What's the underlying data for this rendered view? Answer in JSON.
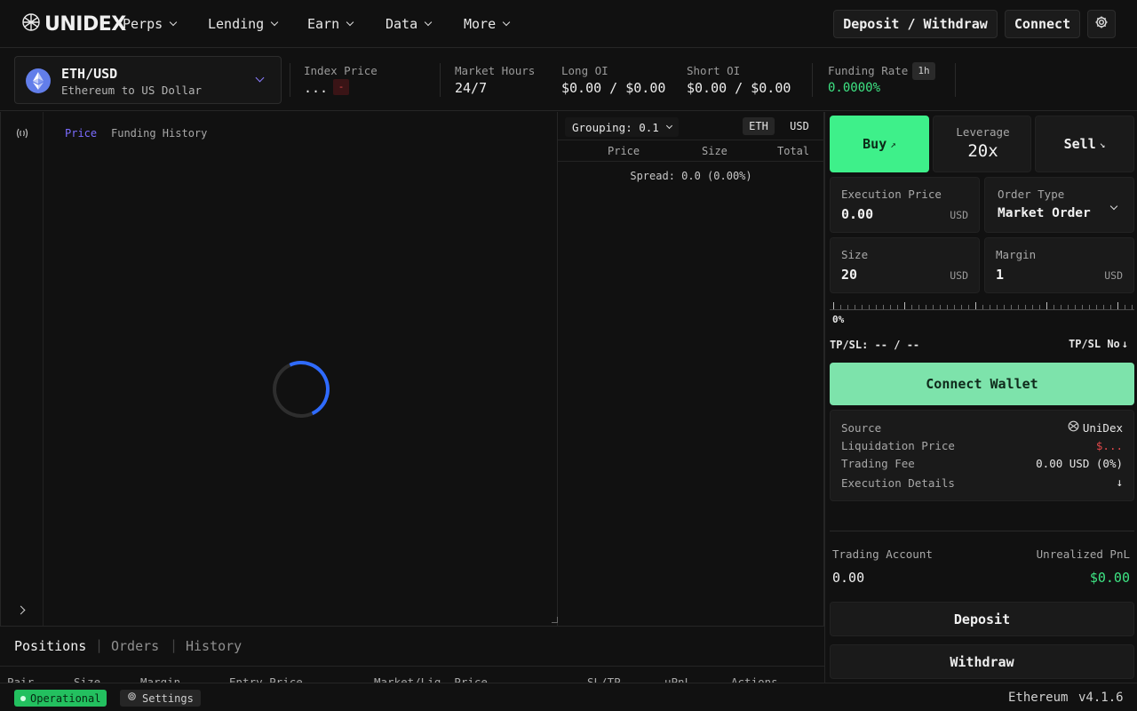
{
  "header": {
    "logo_text": "UNIDEX",
    "nav": [
      {
        "label": "Perps"
      },
      {
        "label": "Lending"
      },
      {
        "label": "Earn"
      },
      {
        "label": "Data"
      },
      {
        "label": "More"
      }
    ],
    "deposit_withdraw_label": "Deposit / Withdraw",
    "connect_label": "Connect"
  },
  "market": {
    "pair": "ETH/USD",
    "pair_desc": "Ethereum to US Dollar",
    "stats": {
      "index_price_label": "Index Price",
      "index_price_value": "...",
      "index_price_change": "-",
      "market_hours_label": "Market Hours",
      "market_hours_value": "24/7",
      "long_oi_label": "Long OI",
      "long_oi_value": "$0.00 / $0.00",
      "short_oi_label": "Short OI",
      "short_oi_value": "$0.00 / $0.00",
      "funding_rate_label": "Funding Rate",
      "funding_interval": "1h",
      "funding_rate_value": "0.0000%"
    }
  },
  "chart": {
    "tabs": [
      "Price",
      "Funding History"
    ],
    "active_tab": "Price"
  },
  "orderbook": {
    "grouping_label": "Grouping: 0.1",
    "unit_eth": "ETH",
    "unit_usd": "USD",
    "columns": [
      "Price",
      "Size",
      "Total"
    ],
    "spread": "Spread: 0.0 (0.00%)"
  },
  "trade": {
    "buy_label": "Buy",
    "buy_arrow": "↗",
    "leverage_label": "Leverage",
    "leverage_value": "20x",
    "sell_label": "Sell",
    "sell_arrow": "↘",
    "execution_price_label": "Execution Price",
    "execution_price_value": "0.00",
    "execution_price_unit": "USD",
    "order_type_label": "Order Type",
    "order_type_value": "Market Order",
    "size_label": "Size",
    "size_value": "20",
    "size_unit": "USD",
    "margin_label": "Margin",
    "margin_value": "1",
    "margin_unit": "USD",
    "slider_percent": "0%",
    "tpsl_label": "TP/SL: -- / --",
    "tpsl_toggle": "TP/SL No",
    "tpsl_arrow": "↓",
    "connect_wallet_label": "Connect Wallet",
    "details": {
      "source_label": "Source",
      "source_value": "UniDex",
      "liquidation_label": "Liquidation Price",
      "liquidation_value": "$...",
      "fee_label": "Trading Fee",
      "fee_value": "0.00 USD (0%)",
      "execution_details_label": "Execution Details",
      "execution_details_arrow": "↓"
    },
    "account": {
      "trading_account_label": "Trading Account",
      "trading_account_value": "0.00",
      "unrealized_pnl_label": "Unrealized PnL",
      "unrealized_pnl_value": "$0.00"
    },
    "deposit_label": "Deposit",
    "withdraw_label": "Withdraw"
  },
  "bottom": {
    "tabs": [
      "Positions",
      "Orders",
      "History"
    ],
    "active_tab": "Positions",
    "columns": [
      "Pair",
      "Size",
      "Margin",
      "Entry Price",
      "Market/Liq. Price",
      "SL/TP",
      "uPnL",
      "Actions"
    ]
  },
  "statusbar": {
    "operational_label": "Operational",
    "settings_label": "Settings",
    "network": "Ethereum",
    "version": "v4.1.6"
  },
  "colors": {
    "buy_green": "#3ef08a",
    "connect_wallet_green": "#7de3ab",
    "accent_blue": "#2f6bff",
    "pnl_green": "#3ee584",
    "funding_green": "#3ee584",
    "liq_red": "#e0484a",
    "tab_active_purple": "#7b6cff"
  }
}
